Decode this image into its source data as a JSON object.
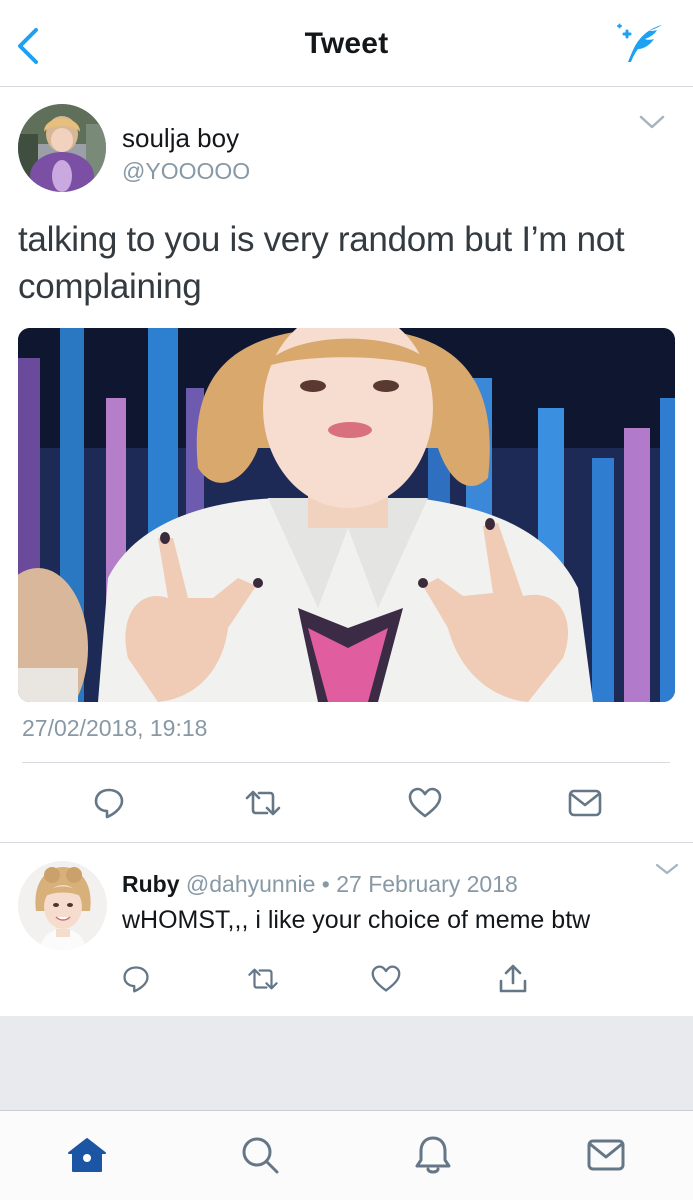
{
  "header": {
    "title": "Tweet",
    "back_icon": "chevron-left-icon",
    "compose_icon": "compose-sparkle-feather-icon"
  },
  "tweet": {
    "author_name": "soulja boy",
    "author_handle": "@YOOOOO",
    "text": "talking to you is very random but I’m not complaining",
    "timestamp": "27/02/2018, 19:18",
    "actions": [
      "reply-icon",
      "retweet-icon",
      "like-icon",
      "message-icon"
    ]
  },
  "reply": {
    "author_name": "Ruby",
    "author_handle": "@dahyunnie",
    "separator": "•",
    "date": "27 February 2018",
    "text": "wHOMST,,, i like your choice of meme btw",
    "actions": [
      "reply-icon",
      "retweet-icon",
      "like-icon",
      "share-icon"
    ]
  },
  "tabbar": {
    "tabs": [
      "home-icon",
      "search-icon",
      "notifications-icon",
      "messages-icon"
    ],
    "active": "home-icon"
  },
  "colors": {
    "accent": "#1da1f2",
    "active_tab": "#1c55a3",
    "icon_gray": "#657786",
    "text_secondary": "#8899a6",
    "divider": "#d7dbdf",
    "background_gray": "#e9eaee"
  }
}
